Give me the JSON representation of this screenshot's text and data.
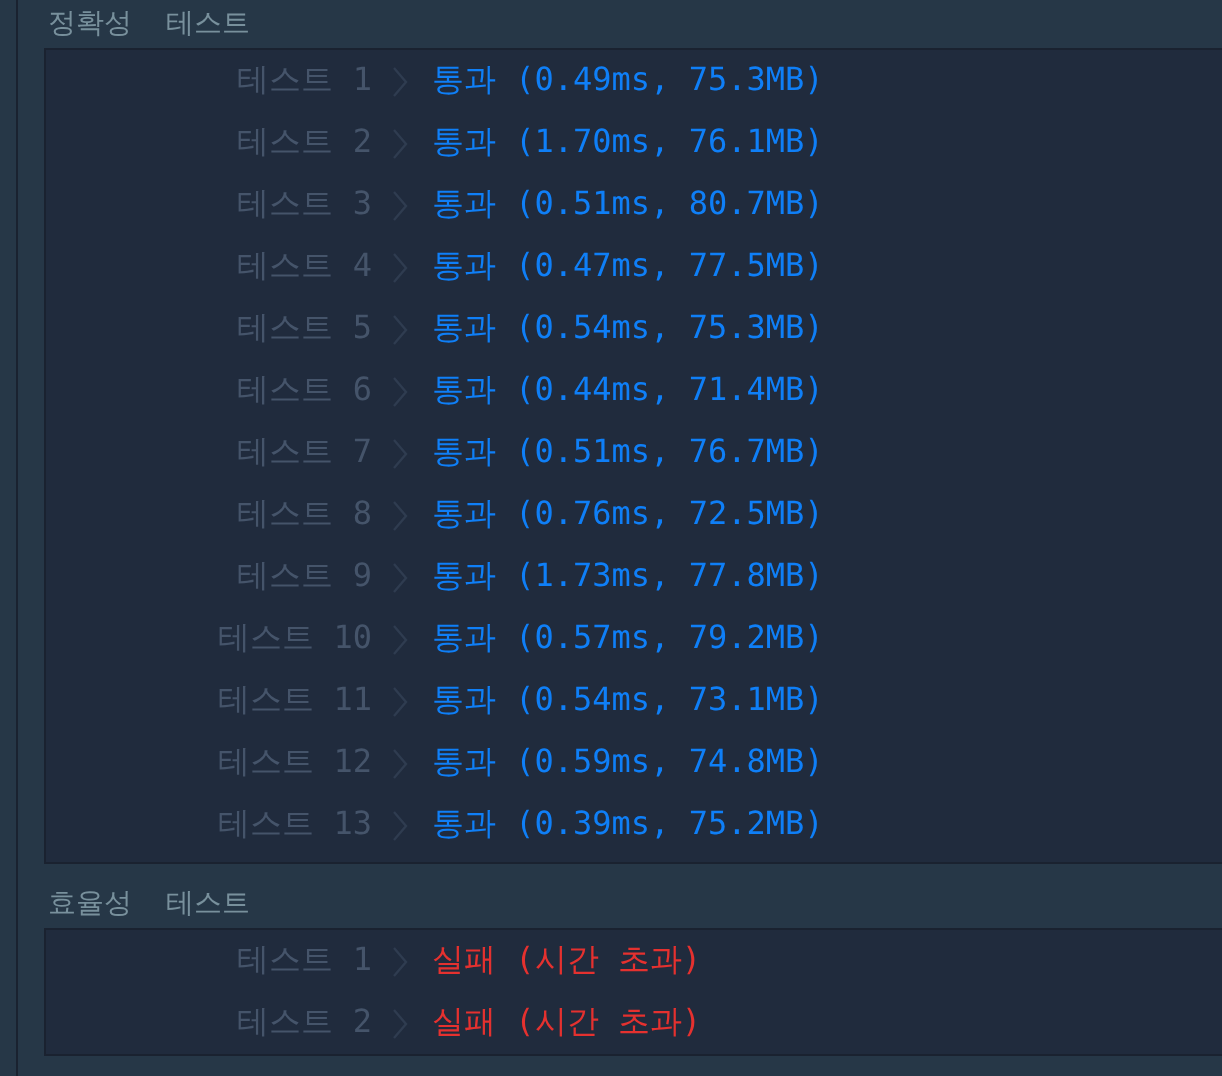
{
  "sections": [
    {
      "title": "정확성  테스트",
      "tests": [
        {
          "label": "테스트 1",
          "result": "통과 (0.49ms, 75.3MB)",
          "passed": true
        },
        {
          "label": "테스트 2",
          "result": "통과 (1.70ms, 76.1MB)",
          "passed": true
        },
        {
          "label": "테스트 3",
          "result": "통과 (0.51ms, 80.7MB)",
          "passed": true
        },
        {
          "label": "테스트 4",
          "result": "통과 (0.47ms, 77.5MB)",
          "passed": true
        },
        {
          "label": "테스트 5",
          "result": "통과 (0.54ms, 75.3MB)",
          "passed": true
        },
        {
          "label": "테스트 6",
          "result": "통과 (0.44ms, 71.4MB)",
          "passed": true
        },
        {
          "label": "테스트 7",
          "result": "통과 (0.51ms, 76.7MB)",
          "passed": true
        },
        {
          "label": "테스트 8",
          "result": "통과 (0.76ms, 72.5MB)",
          "passed": true
        },
        {
          "label": "테스트 9",
          "result": "통과 (1.73ms, 77.8MB)",
          "passed": true
        },
        {
          "label": "테스트 10",
          "result": "통과 (0.57ms, 79.2MB)",
          "passed": true
        },
        {
          "label": "테스트 11",
          "result": "통과 (0.54ms, 73.1MB)",
          "passed": true
        },
        {
          "label": "테스트 12",
          "result": "통과 (0.59ms, 74.8MB)",
          "passed": true
        },
        {
          "label": "테스트 13",
          "result": "통과 (0.39ms, 75.2MB)",
          "passed": true
        }
      ]
    },
    {
      "title": "효율성  테스트",
      "tests": [
        {
          "label": "테스트 1",
          "result": "실패 (시간 초과)",
          "passed": false
        },
        {
          "label": "테스트 2",
          "result": "실패 (시간 초과)",
          "passed": false
        }
      ]
    }
  ]
}
